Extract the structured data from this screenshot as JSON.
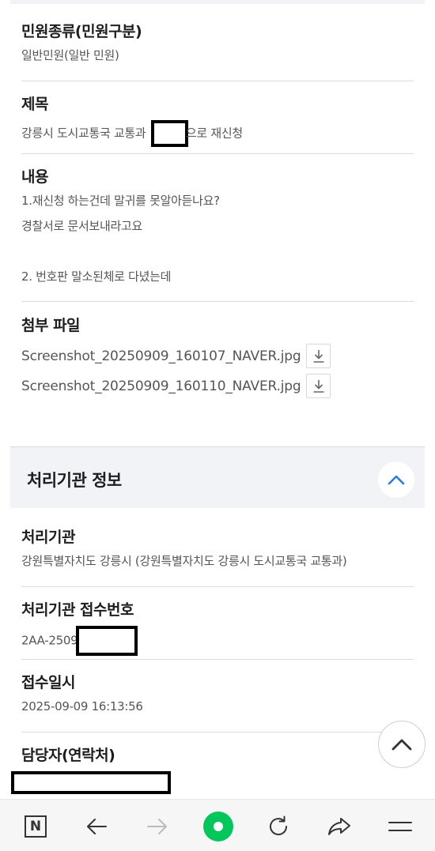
{
  "petition": {
    "type_label": "민원종류(민원구분)",
    "type_value": "일반민원(일반 민원)",
    "title_label": "제목",
    "title_prefix": "강릉시 도시교통국 교통과",
    "title_suffix": "으로 재신청",
    "content_label": "내용",
    "content_lines": [
      "1.재신청 하는건데 말귀를 못알아듣나요?",
      "경찰서로 문서보내라고요",
      "",
      "2. 번호판 말소된체로 다녔는데"
    ],
    "attachments_label": "첨부 파일",
    "attachments": [
      {
        "name": "Screenshot_20250909_160107_NAVER.jpg",
        "icon": "download-icon"
      },
      {
        "name": "Screenshot_20250909_160110_NAVER.jpg",
        "icon": "download-icon"
      }
    ]
  },
  "agency_section": {
    "title": "처리기관 정보",
    "collapse_icon": "chevron-up-icon",
    "agency_label": "처리기관",
    "agency_value": "강원특별자치도 강릉시 (강원특별자치도 강릉시 도시교통국 교통과)",
    "receipt_no_label": "처리기관 접수번호",
    "receipt_no_prefix": "2AA-2509",
    "received_at_label": "접수일시",
    "received_at_value": "2025-09-09 16:13:56",
    "officer_label": "담당자(연락처)"
  },
  "scroll_top_icon": "chevron-up-icon",
  "bottom_bar": [
    {
      "name": "naver-n-icon",
      "glyph": "N"
    },
    {
      "name": "back-arrow-icon"
    },
    {
      "name": "forward-arrow-icon"
    },
    {
      "name": "home-green-icon"
    },
    {
      "name": "refresh-icon"
    },
    {
      "name": "share-icon"
    },
    {
      "name": "menu-icon"
    }
  ],
  "colors": {
    "accent_blue": "#2a7de1",
    "home_green": "#03c75a",
    "section_bg": "#f1f3f6"
  }
}
